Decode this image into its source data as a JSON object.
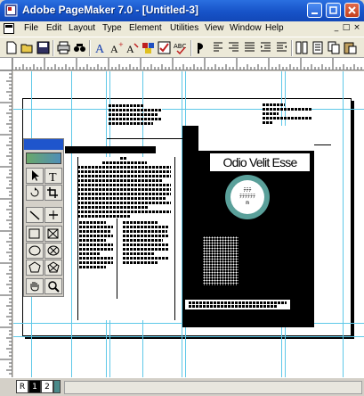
{
  "window": {
    "title": "Adobe PageMaker 7.0 - [Untitled-3]"
  },
  "menubar": {
    "items": [
      "File",
      "Edit",
      "Layout",
      "Type",
      "Element",
      "Utilities",
      "View",
      "Window",
      "Help"
    ],
    "mdi_controls": [
      "_",
      "□",
      "×"
    ]
  },
  "toolbar": {
    "icons": [
      "new-document-icon",
      "open-folder-icon",
      "save-icon",
      "print-icon",
      "find-icon",
      "spelling-icon",
      "font-icon",
      "superscript-icon",
      "kerning-icon",
      "color-icon",
      "check-icon",
      "align-left-icon",
      "align-center-icon",
      "align-right-icon",
      "justify-icon",
      "indent-icon",
      "outdent-icon",
      "columns-icon",
      "page-icon",
      "copy-icon",
      "paste-icon"
    ]
  },
  "document": {
    "headline": "Odio Velit Esse",
    "circle_text": [
      "ﾃﾃﾃ",
      "ﾃﾃﾃﾃﾃﾃ",
      "m"
    ],
    "colors": {
      "accent": "#5aa09a",
      "guide": "#5ec8e8",
      "black_panel": "#000000",
      "title_bar": "#1753c8"
    }
  },
  "palette": {
    "tools": [
      "pointer-tool",
      "text-tool",
      "rotate-tool",
      "crop-tool",
      "line-tool",
      "constrained-line-tool",
      "rectangle-tool",
      "rectangle-frame-tool",
      "ellipse-tool",
      "ellipse-frame-tool",
      "polygon-tool",
      "polygon-frame-tool",
      "hand-tool",
      "zoom-tool"
    ]
  },
  "statusbar": {
    "page_tabs": [
      "R",
      "1",
      "2"
    ]
  }
}
